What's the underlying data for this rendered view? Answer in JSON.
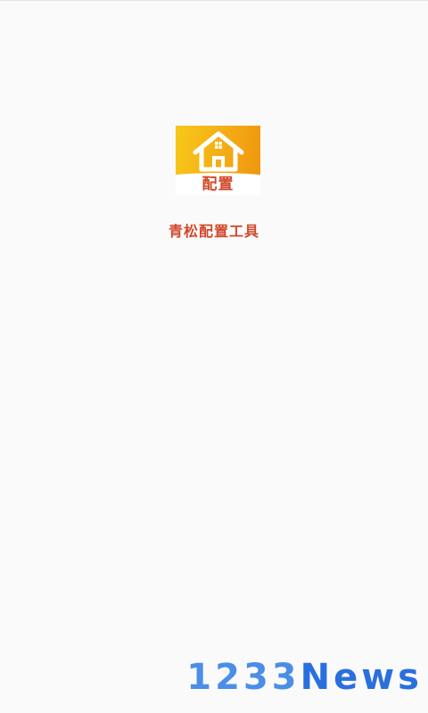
{
  "splash": {
    "logo_text": "配置",
    "app_name": "青松配置工具"
  },
  "watermark": {
    "text": "1233News"
  },
  "colors": {
    "background": "#fafafa",
    "logo_gradient_start": "#f7c81a",
    "logo_gradient_end": "#ef960f",
    "brand_red": "#d2482b",
    "watermark_blue": "#4a8ee8"
  },
  "icons": {
    "logo_icon": "house-icon"
  }
}
